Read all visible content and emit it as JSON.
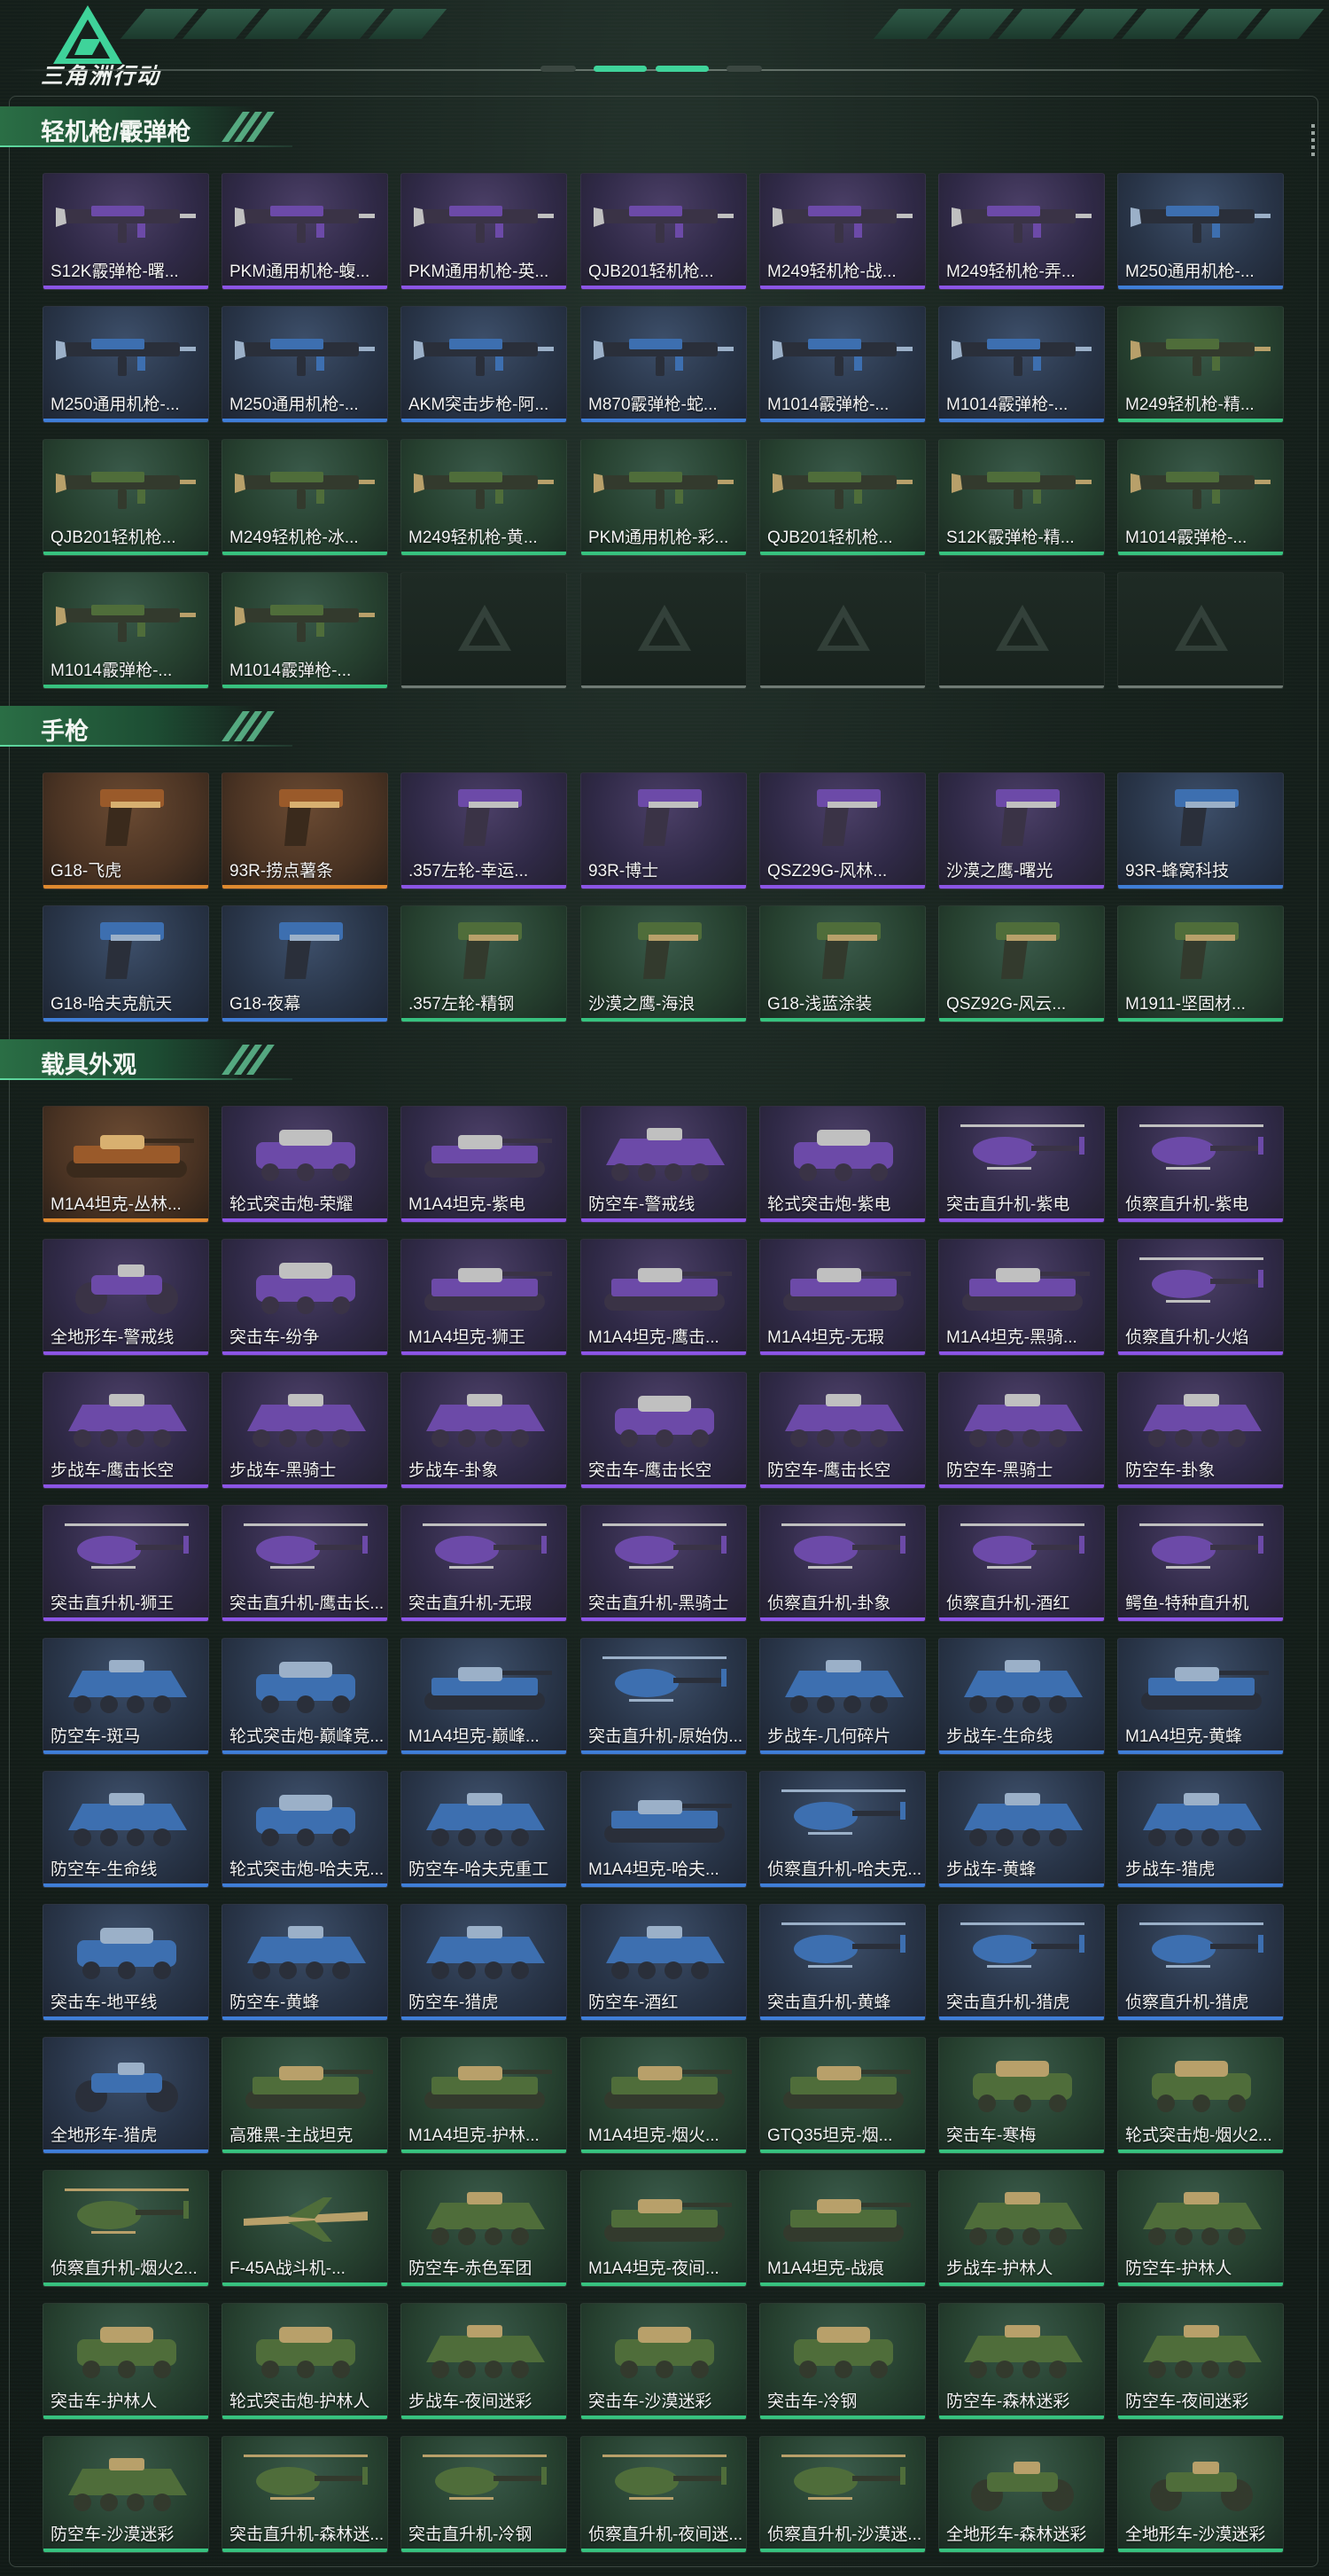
{
  "header": {
    "brand": "三角洲行动",
    "logo_icon": "delta-triangle-logo-icon"
  },
  "colors": {
    "purple": "#8c55e6",
    "blue": "#3f7ed8",
    "green": "#37c27f",
    "orange": "#e08a2f",
    "accent": "#3fd39a"
  },
  "sections": [
    {
      "title": "轻机枪/霰弹枪",
      "kind": "gun",
      "items": [
        {
          "label": "S12K霰弹枪-曙...",
          "rarity": "purple"
        },
        {
          "label": "PKM通用机枪-蝮...",
          "rarity": "purple"
        },
        {
          "label": "PKM通用机枪-英...",
          "rarity": "purple"
        },
        {
          "label": "QJB201轻机枪...",
          "rarity": "purple"
        },
        {
          "label": "M249轻机枪-战...",
          "rarity": "purple"
        },
        {
          "label": "M249轻机枪-弄...",
          "rarity": "purple"
        },
        {
          "label": "M250通用机枪-...",
          "rarity": "blue"
        },
        {
          "label": "M250通用机枪-...",
          "rarity": "blue"
        },
        {
          "label": "M250通用机枪-...",
          "rarity": "blue"
        },
        {
          "label": "AKM突击步枪-阿...",
          "rarity": "blue"
        },
        {
          "label": "M870霰弹枪-蛇...",
          "rarity": "blue"
        },
        {
          "label": "M1014霰弹枪-...",
          "rarity": "blue"
        },
        {
          "label": "M1014霰弹枪-...",
          "rarity": "blue"
        },
        {
          "label": "M249轻机枪-精...",
          "rarity": "green"
        },
        {
          "label": "QJB201轻机枪...",
          "rarity": "green"
        },
        {
          "label": "M249轻机枪-冰...",
          "rarity": "green"
        },
        {
          "label": "M249轻机枪-黄...",
          "rarity": "green"
        },
        {
          "label": "PKM通用机枪-彩...",
          "rarity": "green"
        },
        {
          "label": "QJB201轻机枪...",
          "rarity": "green"
        },
        {
          "label": "S12K霰弹枪-精...",
          "rarity": "green"
        },
        {
          "label": "M1014霰弹枪-...",
          "rarity": "green"
        },
        {
          "label": "M1014霰弹枪-...",
          "rarity": "green"
        },
        {
          "label": "M1014霰弹枪-...",
          "rarity": "green"
        },
        {
          "label": "",
          "rarity": "empty"
        },
        {
          "label": "",
          "rarity": "empty"
        },
        {
          "label": "",
          "rarity": "empty"
        },
        {
          "label": "",
          "rarity": "empty"
        },
        {
          "label": "",
          "rarity": "empty"
        }
      ]
    },
    {
      "title": "手枪",
      "kind": "pistol",
      "items": [
        {
          "label": "G18-飞虎",
          "rarity": "orange"
        },
        {
          "label": "93R-捞点薯条",
          "rarity": "orange"
        },
        {
          "label": ".357左轮-幸运...",
          "rarity": "purple"
        },
        {
          "label": "93R-博士",
          "rarity": "purple"
        },
        {
          "label": "QSZ29G-风林...",
          "rarity": "purple"
        },
        {
          "label": "沙漠之鹰-曙光",
          "rarity": "purple"
        },
        {
          "label": "93R-蜂窝科技",
          "rarity": "blue"
        },
        {
          "label": "G18-哈夫克航天",
          "rarity": "blue"
        },
        {
          "label": "G18-夜幕",
          "rarity": "blue"
        },
        {
          "label": ".357左轮-精钢",
          "rarity": "green"
        },
        {
          "label": "沙漠之鹰-海浪",
          "rarity": "green"
        },
        {
          "label": "G18-浅蓝涂装",
          "rarity": "green"
        },
        {
          "label": "QSZ92G-风云...",
          "rarity": "green"
        },
        {
          "label": "M1911-坚固材...",
          "rarity": "green"
        }
      ]
    },
    {
      "title": "载具外观",
      "kind": "vehicle",
      "items": [
        {
          "label": "M1A4坦克-丛林...",
          "rarity": "orange",
          "v": "tank"
        },
        {
          "label": "轮式突击炮-荣耀",
          "rarity": "purple",
          "v": "car"
        },
        {
          "label": "M1A4坦克-紫电",
          "rarity": "purple",
          "v": "tank"
        },
        {
          "label": "防空车-警戒线",
          "rarity": "purple",
          "v": "apc"
        },
        {
          "label": "轮式突击炮-紫电",
          "rarity": "purple",
          "v": "car"
        },
        {
          "label": "突击直升机-紫电",
          "rarity": "purple",
          "v": "heli"
        },
        {
          "label": "侦察直升机-紫电",
          "rarity": "purple",
          "v": "heli"
        },
        {
          "label": "全地形车-警戒线",
          "rarity": "purple",
          "v": "atv"
        },
        {
          "label": "突击车-纷争",
          "rarity": "purple",
          "v": "car"
        },
        {
          "label": "M1A4坦克-狮王",
          "rarity": "purple",
          "v": "tank"
        },
        {
          "label": "M1A4坦克-鹰击...",
          "rarity": "purple",
          "v": "tank"
        },
        {
          "label": "M1A4坦克-无瑕",
          "rarity": "purple",
          "v": "tank"
        },
        {
          "label": "M1A4坦克-黑骑...",
          "rarity": "purple",
          "v": "tank"
        },
        {
          "label": "侦察直升机-火焰",
          "rarity": "purple",
          "v": "heli"
        },
        {
          "label": "步战车-鹰击长空",
          "rarity": "purple",
          "v": "apc"
        },
        {
          "label": "步战车-黑骑士",
          "rarity": "purple",
          "v": "apc"
        },
        {
          "label": "步战车-卦象",
          "rarity": "purple",
          "v": "apc"
        },
        {
          "label": "突击车-鹰击长空",
          "rarity": "purple",
          "v": "car"
        },
        {
          "label": "防空车-鹰击长空",
          "rarity": "purple",
          "v": "apc"
        },
        {
          "label": "防空车-黑骑士",
          "rarity": "purple",
          "v": "apc"
        },
        {
          "label": "防空车-卦象",
          "rarity": "purple",
          "v": "apc"
        },
        {
          "label": "突击直升机-狮王",
          "rarity": "purple",
          "v": "heli"
        },
        {
          "label": "突击直升机-鹰击长...",
          "rarity": "purple",
          "v": "heli"
        },
        {
          "label": "突击直升机-无瑕",
          "rarity": "purple",
          "v": "heli"
        },
        {
          "label": "突击直升机-黑骑士",
          "rarity": "purple",
          "v": "heli"
        },
        {
          "label": "侦察直升机-卦象",
          "rarity": "purple",
          "v": "heli"
        },
        {
          "label": "侦察直升机-酒红",
          "rarity": "purple",
          "v": "heli"
        },
        {
          "label": "鳄鱼-特种直升机",
          "rarity": "purple",
          "v": "heli"
        },
        {
          "label": "防空车-斑马",
          "rarity": "blue",
          "v": "apc"
        },
        {
          "label": "轮式突击炮-巅峰竞...",
          "rarity": "blue",
          "v": "car"
        },
        {
          "label": "M1A4坦克-巅峰...",
          "rarity": "blue",
          "v": "tank"
        },
        {
          "label": "突击直升机-原始伪...",
          "rarity": "blue",
          "v": "heli"
        },
        {
          "label": "步战车-几何碎片",
          "rarity": "blue",
          "v": "apc"
        },
        {
          "label": "步战车-生命线",
          "rarity": "blue",
          "v": "apc"
        },
        {
          "label": "M1A4坦克-黄蜂",
          "rarity": "blue",
          "v": "tank"
        },
        {
          "label": "防空车-生命线",
          "rarity": "blue",
          "v": "apc"
        },
        {
          "label": "轮式突击炮-哈夫克...",
          "rarity": "blue",
          "v": "car"
        },
        {
          "label": "防空车-哈夫克重工",
          "rarity": "blue",
          "v": "apc"
        },
        {
          "label": "M1A4坦克-哈夫...",
          "rarity": "blue",
          "v": "tank"
        },
        {
          "label": "侦察直升机-哈夫克...",
          "rarity": "blue",
          "v": "heli"
        },
        {
          "label": "步战车-黄蜂",
          "rarity": "blue",
          "v": "apc"
        },
        {
          "label": "步战车-猎虎",
          "rarity": "blue",
          "v": "apc"
        },
        {
          "label": "突击车-地平线",
          "rarity": "blue",
          "v": "car"
        },
        {
          "label": "防空车-黄蜂",
          "rarity": "blue",
          "v": "apc"
        },
        {
          "label": "防空车-猎虎",
          "rarity": "blue",
          "v": "apc"
        },
        {
          "label": "防空车-酒红",
          "rarity": "blue",
          "v": "apc"
        },
        {
          "label": "突击直升机-黄蜂",
          "rarity": "blue",
          "v": "heli"
        },
        {
          "label": "突击直升机-猎虎",
          "rarity": "blue",
          "v": "heli"
        },
        {
          "label": "侦察直升机-猎虎",
          "rarity": "blue",
          "v": "heli"
        },
        {
          "label": "全地形车-猎虎",
          "rarity": "blue",
          "v": "atv"
        },
        {
          "label": "高雅黑-主战坦克",
          "rarity": "green",
          "v": "tank"
        },
        {
          "label": "M1A4坦克-护林...",
          "rarity": "green",
          "v": "tank"
        },
        {
          "label": "M1A4坦克-烟火...",
          "rarity": "green",
          "v": "tank"
        },
        {
          "label": "GTQ35坦克-烟...",
          "rarity": "green",
          "v": "tank"
        },
        {
          "label": "突击车-寒梅",
          "rarity": "green",
          "v": "car"
        },
        {
          "label": "轮式突击炮-烟火2...",
          "rarity": "green",
          "v": "car"
        },
        {
          "label": "侦察直升机-烟火2...",
          "rarity": "green",
          "v": "heli"
        },
        {
          "label": "F-45A战斗机-...",
          "rarity": "green",
          "v": "jet"
        },
        {
          "label": "防空车-赤色军团",
          "rarity": "green",
          "v": "apc"
        },
        {
          "label": "M1A4坦克-夜间...",
          "rarity": "green",
          "v": "tank"
        },
        {
          "label": "M1A4坦克-战痕",
          "rarity": "green",
          "v": "tank"
        },
        {
          "label": "步战车-护林人",
          "rarity": "green",
          "v": "apc"
        },
        {
          "label": "防空车-护林人",
          "rarity": "green",
          "v": "apc"
        },
        {
          "label": "突击车-护林人",
          "rarity": "green",
          "v": "car"
        },
        {
          "label": "轮式突击炮-护林人",
          "rarity": "green",
          "v": "car"
        },
        {
          "label": "步战车-夜间迷彩",
          "rarity": "green",
          "v": "apc"
        },
        {
          "label": "突击车-沙漠迷彩",
          "rarity": "green",
          "v": "car"
        },
        {
          "label": "突击车-冷钢",
          "rarity": "green",
          "v": "car"
        },
        {
          "label": "防空车-森林迷彩",
          "rarity": "green",
          "v": "apc"
        },
        {
          "label": "防空车-夜间迷彩",
          "rarity": "green",
          "v": "apc"
        },
        {
          "label": "防空车-沙漠迷彩",
          "rarity": "green",
          "v": "apc"
        },
        {
          "label": "突击直升机-森林迷...",
          "rarity": "green",
          "v": "heli"
        },
        {
          "label": "突击直升机-冷钢",
          "rarity": "green",
          "v": "heli"
        },
        {
          "label": "侦察直升机-夜间迷...",
          "rarity": "green",
          "v": "heli"
        },
        {
          "label": "侦察直升机-沙漠迷...",
          "rarity": "green",
          "v": "heli"
        },
        {
          "label": "全地形车-森林迷彩",
          "rarity": "green",
          "v": "atv"
        },
        {
          "label": "全地形车-沙漠迷彩",
          "rarity": "green",
          "v": "atv"
        }
      ]
    }
  ]
}
